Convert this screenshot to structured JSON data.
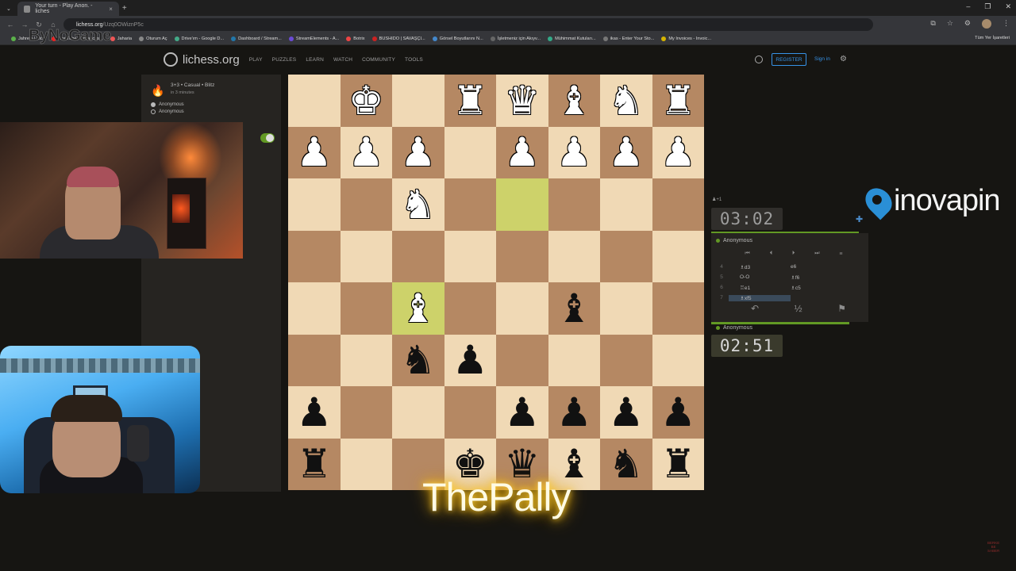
{
  "browser": {
    "tabs": [
      {
        "label": "Your turn - Play Anon. - liches"
      }
    ],
    "url": {
      "host": "lichess.org",
      "path": "/Uzq0OWiznP5c"
    },
    "bookmarks": [
      "Jahrein | Kick",
      "YouTube - Broadcas...",
      "Jaharia",
      "Oturum Aç",
      "Drive'ım - Google D...",
      "Dashboard / Stream...",
      "StreamElements - A...",
      "Botrix",
      "BUSHIDO | SAVAŞÇI...",
      "Görsel Boyutlarını N...",
      "İşletmeniz için Akıyv...",
      "Mühimmat Kutuları...",
      "ikas - Enter Your Sto...",
      "My Invoices - Invoic..."
    ],
    "bookmarks_all": "Tüm Yer İşaretleri"
  },
  "overlay": {
    "watermark": "ByNoGame",
    "streamer": "ThePally",
    "sponsor": "inovapin",
    "corner": "BERKE\nBE\nSABER"
  },
  "lichess": {
    "brand": "lichess.org",
    "nav": [
      "PLAY",
      "PUZZLES",
      "LEARN",
      "WATCH",
      "COMMUNITY",
      "TOOLS"
    ],
    "register": "REGISTER",
    "signin": "Sign in"
  },
  "game": {
    "title": "3+3 • Casual • Blitz",
    "subtitle": "in 3 minutes",
    "players": [
      "Anonymous",
      "Anonymous"
    ],
    "top_clock": "03:02",
    "bottom_clock": "02:51",
    "top_player": "Anonymous",
    "bottom_player": "Anonymous",
    "rank_marker": "♟+1",
    "moves": [
      {
        "n": "4",
        "w": "♗d3",
        "b": "e6"
      },
      {
        "n": "5",
        "w": "O-O",
        "b": "♗f6"
      },
      {
        "n": "6",
        "w": "♖e1",
        "b": "♗c5"
      },
      {
        "n": "7",
        "w": "♗xf5",
        "b": ""
      }
    ],
    "move_controls": [
      "⏮",
      "⏴",
      "⏵",
      "⏭",
      "≡"
    ],
    "actions": [
      "↶",
      "½",
      "⚑"
    ]
  },
  "board": [
    [
      "",
      "K",
      "",
      "R",
      "Q",
      "B",
      "N",
      "R"
    ],
    [
      "P",
      "P",
      "P",
      "",
      "P",
      "P",
      "P",
      "P"
    ],
    [
      "",
      "",
      "N",
      "",
      "",
      "",
      "",
      ""
    ],
    [
      "",
      "",
      "",
      "",
      "",
      "",
      "",
      ""
    ],
    [
      "",
      "",
      "B",
      "",
      "",
      "b",
      "",
      ""
    ],
    [
      "",
      "",
      "n",
      "p",
      "",
      "",
      "",
      ""
    ],
    [
      "p",
      "",
      "",
      "",
      "p",
      "p",
      "p",
      "p"
    ],
    [
      "r",
      "",
      "",
      "k",
      "q",
      "b",
      "n",
      "r"
    ]
  ],
  "highlights": [
    [
      2,
      4
    ],
    [
      4,
      2
    ]
  ],
  "colors": {
    "light": "#f0d9b5",
    "dark": "#b58863",
    "highlight": "#cdd26a",
    "accent": "#3692e7",
    "online": "#629924"
  }
}
